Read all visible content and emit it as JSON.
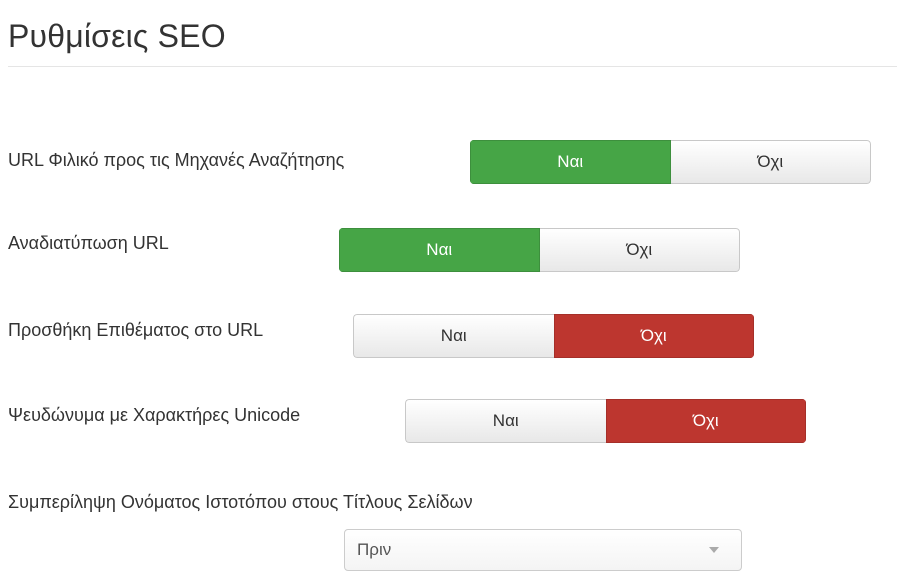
{
  "page": {
    "title": "Ρυθμίσεις SEO"
  },
  "settings": [
    {
      "label": "URL Φιλικό προς τις Μηχανές Αναζήτησης",
      "yes": "Ναι",
      "no": "Όχι",
      "selected": "yes",
      "active_color": "#46a546"
    },
    {
      "label": "Αναδιατύπωση URL",
      "yes": "Ναι",
      "no": "Όχι",
      "selected": "yes",
      "active_color": "#46a546"
    },
    {
      "label": "Προσθήκη Επιθέματος στο URL",
      "yes": "Ναι",
      "no": "Όχι",
      "selected": "no",
      "active_color": "#bd362f"
    },
    {
      "label": "Ψευδώνυμα με Χαρακτήρες Unicode",
      "yes": "Ναι",
      "no": "Όχι",
      "selected": "no",
      "active_color": "#bd362f"
    }
  ],
  "site_name_in_titles": {
    "label": "Συμπερίληψη Ονόματος Ιστοτόπου στους Τίτλους Σελίδων",
    "selected_option": "Πριν",
    "dropdown_icon": "caret-down-icon"
  }
}
